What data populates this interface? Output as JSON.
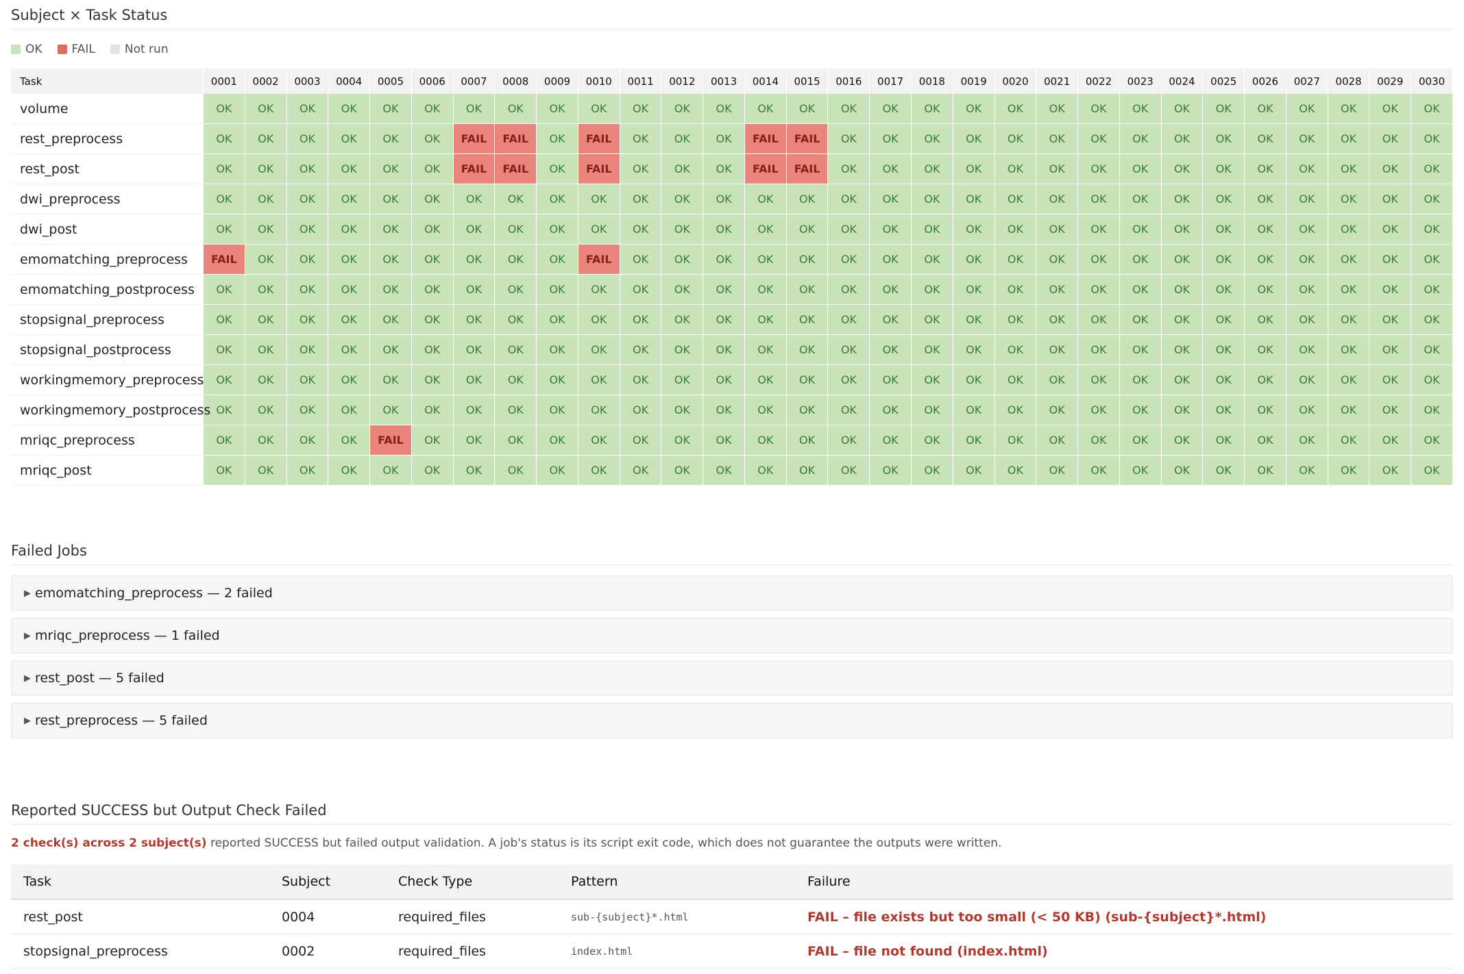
{
  "status_section": {
    "title": "Subject × Task Status",
    "legend": [
      {
        "label": "OK",
        "color": "#b9dba4"
      },
      {
        "label": "FAIL",
        "color": "#e06b63"
      },
      {
        "label": "Not run",
        "color": "#e4e4e4"
      }
    ],
    "task_header": "Task",
    "subjects": [
      "0001",
      "0002",
      "0003",
      "0004",
      "0005",
      "0006",
      "0007",
      "0008",
      "0009",
      "0010",
      "0011",
      "0012",
      "0013",
      "0014",
      "0015",
      "0016",
      "0017",
      "0018",
      "0019",
      "0020",
      "0021",
      "0022",
      "0023",
      "0024",
      "0025",
      "0026",
      "0027",
      "0028",
      "0029",
      "0030"
    ],
    "ok_label": "OK",
    "fail_label": "FAIL",
    "rows": [
      {
        "task": "volume",
        "fails": []
      },
      {
        "task": "rest_preprocess",
        "fails": [
          "0007",
          "0008",
          "0010",
          "0014",
          "0015"
        ]
      },
      {
        "task": "rest_post",
        "fails": [
          "0007",
          "0008",
          "0010",
          "0014",
          "0015"
        ]
      },
      {
        "task": "dwi_preprocess",
        "fails": []
      },
      {
        "task": "dwi_post",
        "fails": []
      },
      {
        "task": "emomatching_preprocess",
        "fails": [
          "0001",
          "0010"
        ]
      },
      {
        "task": "emomatching_postprocess",
        "fails": []
      },
      {
        "task": "stopsignal_preprocess",
        "fails": []
      },
      {
        "task": "stopsignal_postprocess",
        "fails": []
      },
      {
        "task": "workingmemory_preprocess",
        "fails": []
      },
      {
        "task": "workingmemory_postprocess",
        "fails": []
      },
      {
        "task": "mriqc_preprocess",
        "fails": [
          "0005"
        ]
      },
      {
        "task": "mriqc_post",
        "fails": []
      }
    ]
  },
  "failed_section": {
    "title": "Failed Jobs",
    "items": [
      {
        "label": "emomatching_preprocess — 2 failed"
      },
      {
        "label": "mriqc_preprocess — 1 failed"
      },
      {
        "label": "rest_post — 5 failed"
      },
      {
        "label": "rest_preprocess — 5 failed"
      }
    ]
  },
  "success_section": {
    "title": "Reported SUCCESS but Output Check Failed",
    "note_highlight": "2 check(s) across 2 subject(s)",
    "note_rest": " reported SUCCESS but failed output validation. A job's status is its script exit code, which does not guarantee the outputs were written.",
    "columns": [
      "Task",
      "Subject",
      "Check Type",
      "Pattern",
      "Failure"
    ],
    "rows": [
      {
        "task": "rest_post",
        "subject": "0004",
        "check_type": "required_files",
        "pattern": "sub-{subject}*.html",
        "failure": "FAIL – file exists but too small (< 50 KB) (sub-{subject}*.html)"
      },
      {
        "task": "stopsignal_preprocess",
        "subject": "0002",
        "check_type": "required_files",
        "pattern": "index.html",
        "failure": "FAIL – file not found (index.html)"
      }
    ]
  }
}
